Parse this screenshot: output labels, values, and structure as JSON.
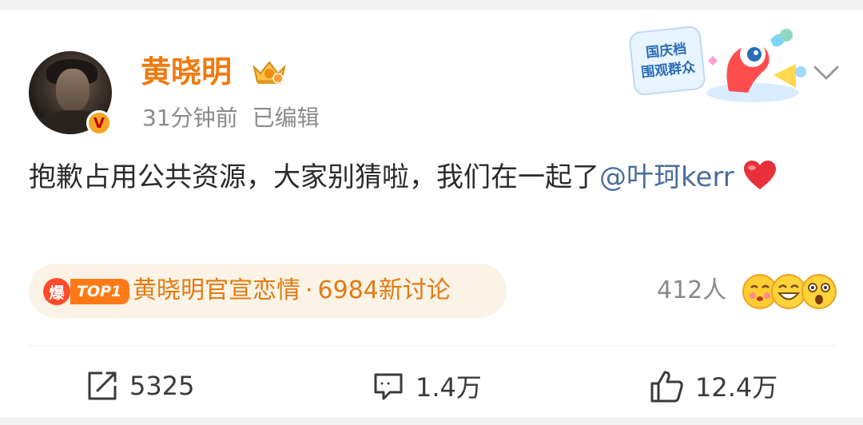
{
  "post": {
    "author": "黄晓明",
    "time": "31分钟前",
    "edited": "已编辑",
    "verified_badge": "V",
    "content_text": "抱歉占用公共资源，大家别猜啦，我们在一起了",
    "mention": "@叶珂kerr",
    "heart_icon": "heart-icon"
  },
  "promo": {
    "line1": "国庆档",
    "line2": "围观群众"
  },
  "trend": {
    "hot_label": "爆",
    "rank_label": "TOP1",
    "topic": "黄晓明官宣恋情",
    "separator": "·",
    "count": "6984新讨论"
  },
  "reactions": {
    "count": "412人"
  },
  "actions": {
    "share": "5325",
    "comment": "1.4万",
    "like": "12.4万"
  },
  "colors": {
    "username": "#f07a10",
    "mention": "#4a6e9c",
    "trend_bg": "#fbf3e6",
    "trend_text": "#e27a12",
    "meta_gray": "#8a8a8a"
  }
}
